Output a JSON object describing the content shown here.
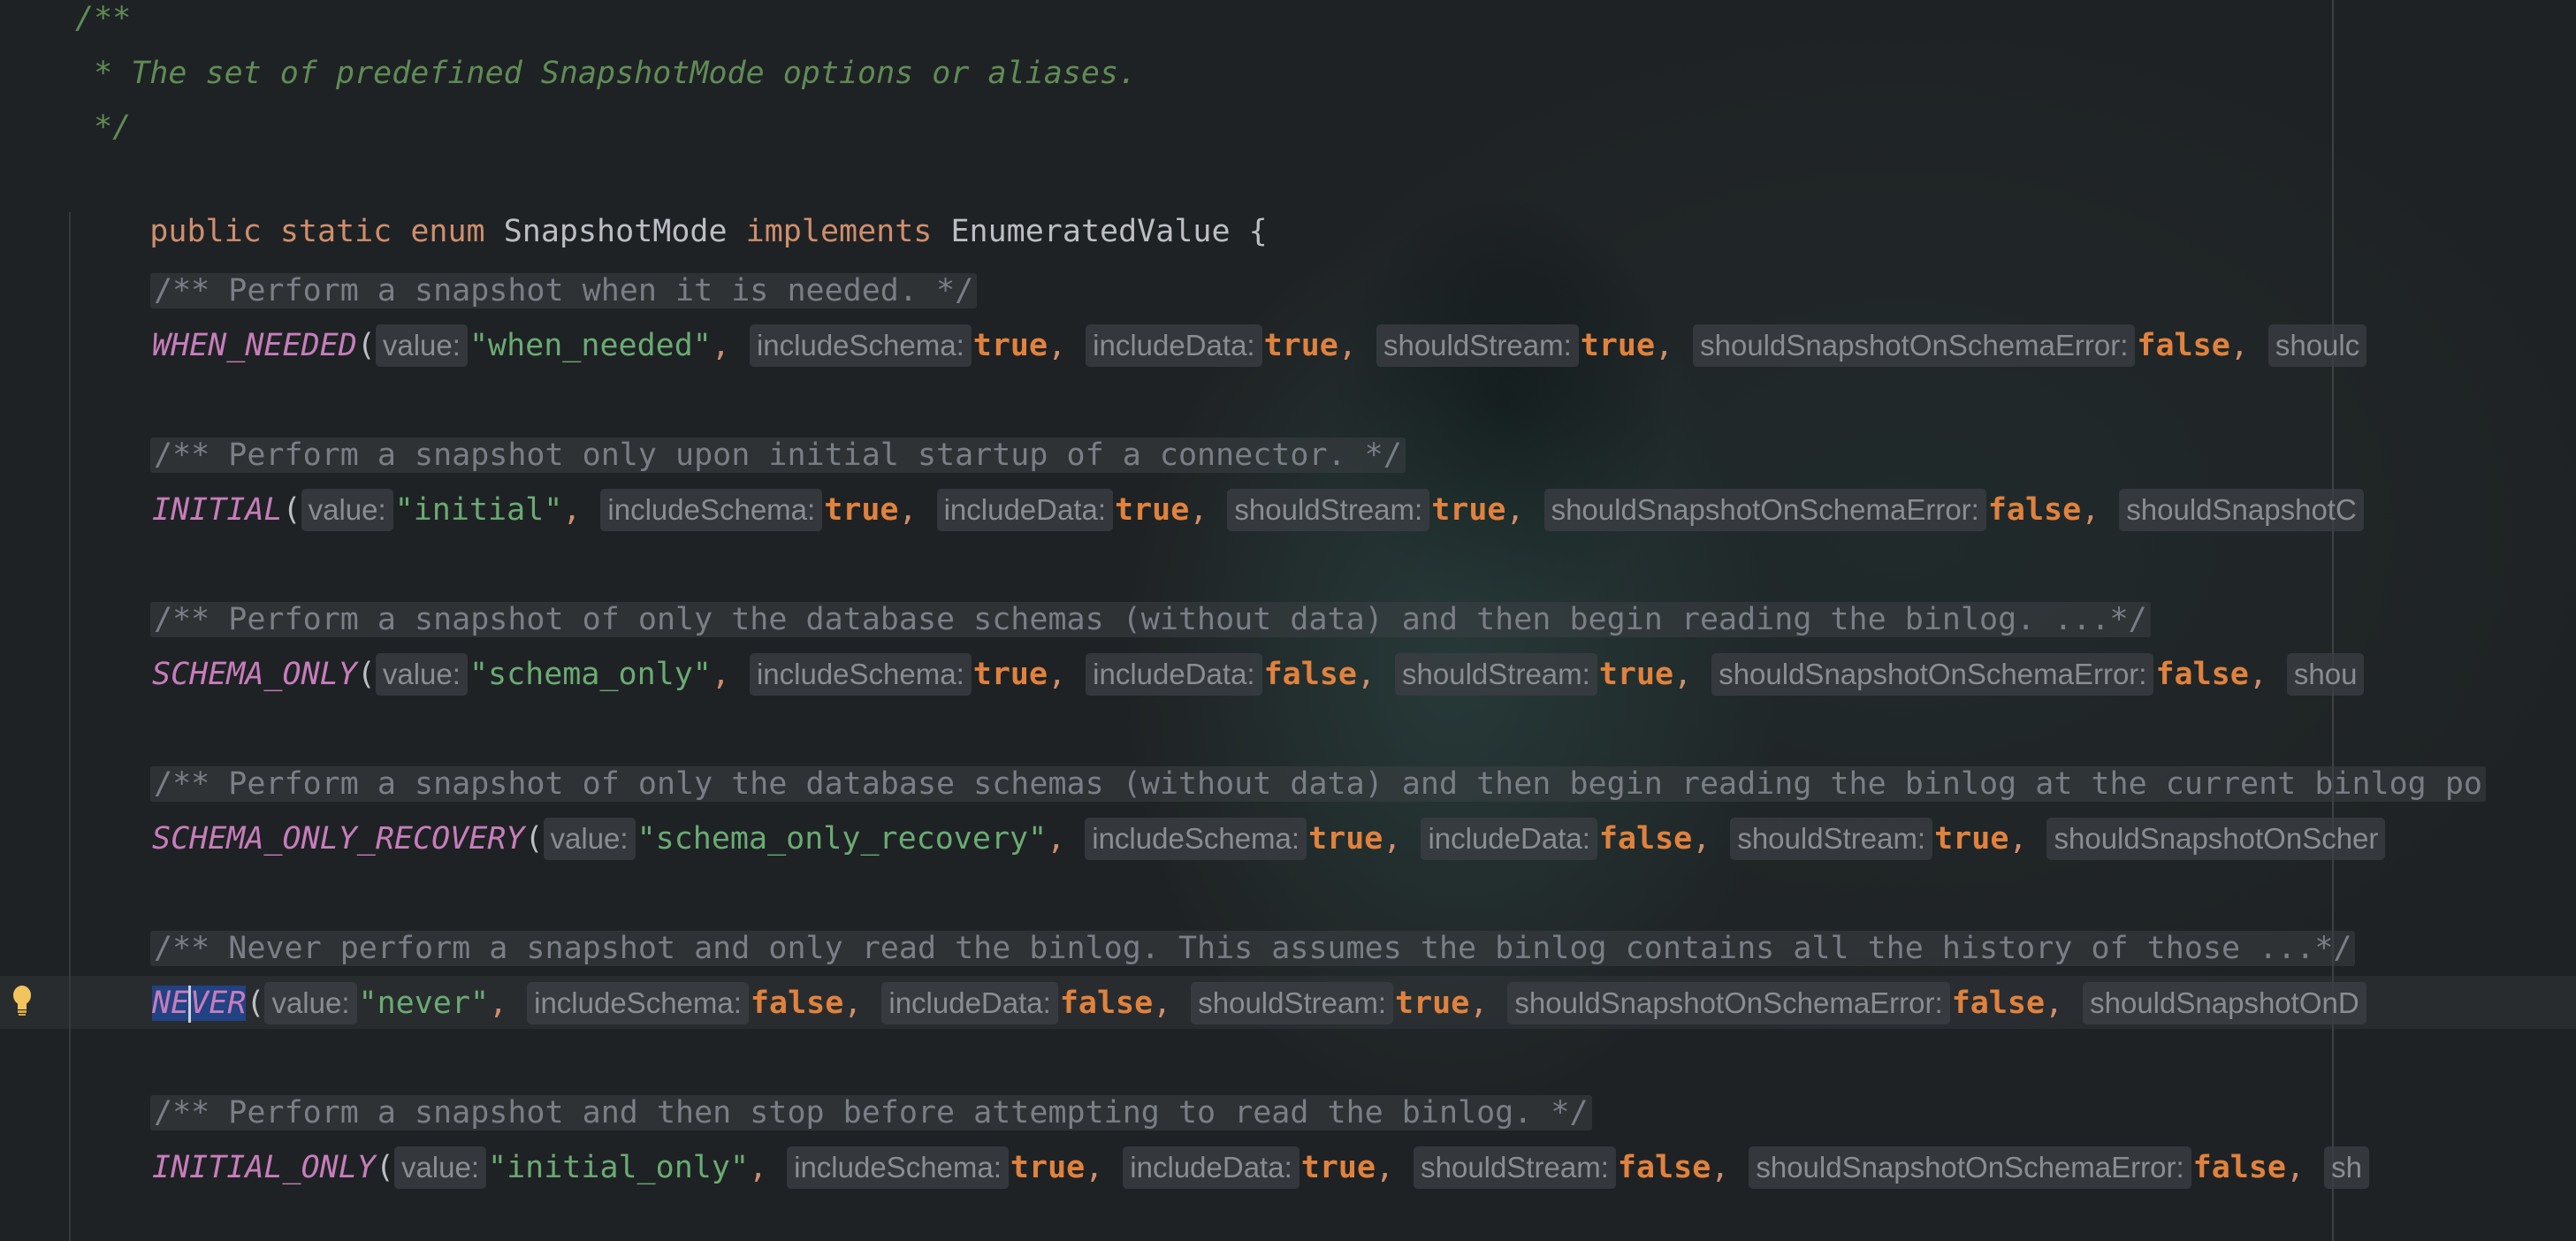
{
  "header": {
    "doc_open": "/**",
    "doc_text": " * The set of predefined SnapshotMode options or aliases.",
    "doc_close": " */",
    "kw_public": "public",
    "kw_static": "static",
    "kw_enum": "enum",
    "enum_name": "SnapshotMode",
    "kw_implements": "implements",
    "iface": "EnumeratedValue",
    "brace": "{"
  },
  "hint_labels": {
    "value": "value:",
    "includeSchema": "includeSchema:",
    "includeData": "includeData:",
    "shouldStream": "shouldStream:",
    "shouldSnapshotOnSchemaError": "shouldSnapshotOnSchemaError:"
  },
  "entries": [
    {
      "comment": "/** Perform a snapshot when it is needed. */",
      "name": "WHEN_NEEDED",
      "value": "\"when_needed\"",
      "includeSchema": "true",
      "includeData": "true",
      "shouldStream": "true",
      "shouldSnapshotOnSchemaError": "false",
      "trailing_hint": "shoulc"
    },
    {
      "comment": "/** Perform a snapshot only upon initial startup of a connector. */",
      "name": "INITIAL",
      "value": "\"initial\"",
      "includeSchema": "true",
      "includeData": "true",
      "shouldStream": "true",
      "shouldSnapshotOnSchemaError": "false",
      "trailing_hint": "shouldSnapshotC"
    },
    {
      "comment": "/** Perform a snapshot of only the database schemas (without data) and then begin reading the binlog. ...*/",
      "name": "SCHEMA_ONLY",
      "value": "\"schema_only\"",
      "includeSchema": "true",
      "includeData": "false",
      "shouldStream": "true",
      "shouldSnapshotOnSchemaError": "false",
      "trailing_hint": "shou"
    },
    {
      "comment": "/** Perform a snapshot of only the database schemas (without data) and then begin reading the binlog at the current binlog po",
      "name": "SCHEMA_ONLY_RECOVERY",
      "value": "\"schema_only_recovery\"",
      "includeSchema": "true",
      "includeData": "false",
      "shouldStream": "true",
      "trailing_hint": "shouldSnapshotOnScher"
    },
    {
      "comment": "/** Never perform a snapshot and only read the binlog. This assumes the binlog contains all the history of those ...*/",
      "name_selected": "NE",
      "name_selected_rest": "VER",
      "value": "\"never\"",
      "includeSchema": "false",
      "includeData": "false",
      "shouldStream": "true",
      "shouldSnapshotOnSchemaError": "false",
      "trailing_hint": "shouldSnapshotOnD"
    },
    {
      "comment": "/** Perform a snapshot and then stop before attempting to read the binlog. */",
      "name": "INITIAL_ONLY",
      "value": "\"initial_only\"",
      "includeSchema": "true",
      "includeData": "true",
      "shouldStream": "false",
      "shouldSnapshotOnSchemaError": "false",
      "trailing_hint": "sh"
    }
  ],
  "punct": {
    "open_paren": "(",
    "comma": ","
  },
  "colors": {
    "background": "#1f2224",
    "keyword": "#cf8e6d",
    "enum_constant": "#c77dbb",
    "string": "#6aab73",
    "boolean": "#e0823d",
    "doc_comment": "#5f8c56",
    "block_comment": "#7a7e85",
    "selection": "#214283"
  },
  "icons": {
    "gutter": "lightbulb-icon"
  }
}
